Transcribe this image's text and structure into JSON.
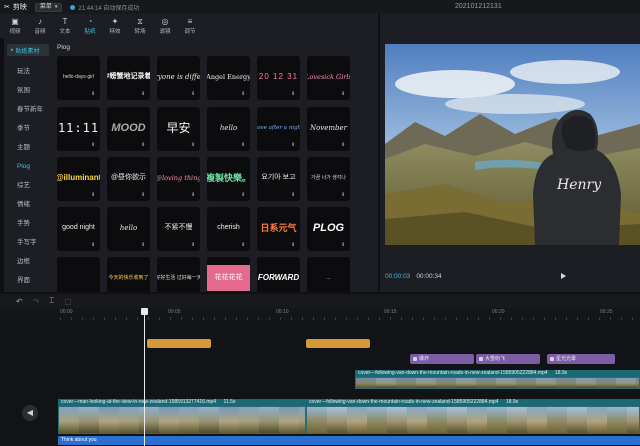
{
  "titlebar": {
    "app_name": "剪映",
    "menu_label": "菜单",
    "save_status": "21:44:14 自动保存成功",
    "project_name": "202101212131"
  },
  "toolbar": {
    "items": [
      {
        "label": "视频",
        "icon": "video-icon",
        "active": false
      },
      {
        "label": "音频",
        "icon": "audio-icon",
        "active": false
      },
      {
        "label": "文本",
        "icon": "text-icon",
        "active": false
      },
      {
        "label": "贴纸",
        "icon": "sticker-icon",
        "active": true
      },
      {
        "label": "特效",
        "icon": "effects-icon",
        "active": false
      },
      {
        "label": "转场",
        "icon": "transition-icon",
        "active": false
      },
      {
        "label": "滤镜",
        "icon": "filter-icon",
        "active": false
      },
      {
        "label": "调节",
        "icon": "adjust-icon",
        "active": false
      }
    ]
  },
  "left_nav": {
    "top_item": "贴纸素材",
    "items": [
      {
        "label": "玩法",
        "active": false
      },
      {
        "label": "氛围",
        "active": false
      },
      {
        "label": "春节新年",
        "active": false
      },
      {
        "label": "季节",
        "active": false
      },
      {
        "label": "主题",
        "active": false
      },
      {
        "label": "Plog",
        "active": true
      },
      {
        "label": "综艺",
        "active": false
      },
      {
        "label": "情绪",
        "active": false
      },
      {
        "label": "手势",
        "active": false
      },
      {
        "label": "手写字",
        "active": false
      },
      {
        "label": "边框",
        "active": false
      },
      {
        "label": "界面",
        "active": false
      }
    ]
  },
  "library": {
    "section_title": "Plog",
    "rows": [
      [
        {
          "text": "hello·days·girl",
          "style": "small"
        },
        {
          "text": "#螃蟹地记录着",
          "style": "bold"
        },
        {
          "text": "Everyone is different",
          "style": "script"
        },
        {
          "text": "Angel Energy",
          "style": "serif"
        },
        {
          "text": "20 12 31",
          "style": "pink"
        },
        {
          "text": "Lovesick Girls",
          "style": "pinkscript"
        }
      ],
      [
        {
          "text": "11:11",
          "style": "digital"
        },
        {
          "text": "MOOD",
          "style": "mood"
        },
        {
          "text": "早安",
          "style": "brush"
        },
        {
          "text": "hello",
          "style": "script"
        },
        {
          "text": "Love after a night",
          "style": "bluescript"
        },
        {
          "text": "November",
          "style": "script"
        }
      ],
      [
        {
          "text": "@illuminant",
          "style": "yellow"
        },
        {
          "text": "@昼你欲示",
          "style": "plain"
        },
        {
          "text": "@loving thing",
          "style": "pinkscript"
        },
        {
          "text": "複製快樂。",
          "style": "green"
        },
        {
          "text": "요기아 보고",
          "style": "plain"
        },
        {
          "text": "가끔 너가 생각나",
          "style": "small"
        }
      ],
      [
        {
          "text": "good night",
          "style": "plain"
        },
        {
          "text": "hello",
          "style": "script"
        },
        {
          "text": "不紧不慢",
          "style": "plain"
        },
        {
          "text": "cherish",
          "style": "plain"
        },
        {
          "text": "日系元气",
          "style": "orange"
        },
        {
          "text": "PLOG",
          "style": "plog"
        }
      ],
      [
        {
          "text": "",
          "style": "blue"
        },
        {
          "text": "今天的快乐收到了",
          "style": "yellowsmall"
        },
        {
          "text": "好好生活 过好每一天",
          "style": "small"
        },
        {
          "text": "花花花花",
          "style": "pinkbox"
        },
        {
          "text": "FORWARD",
          "style": "forward"
        },
        {
          "text": "...",
          "style": "small"
        }
      ]
    ]
  },
  "player": {
    "current_time": "00:00:03",
    "total_time": "00:00:34"
  },
  "timeline": {
    "ruler_ticks": [
      "00:00",
      "00:05",
      "00:10",
      "00:15",
      "00:20",
      "00:25"
    ],
    "effect_clips": [
      {
        "label": "爆炸"
      },
      {
        "label": "大雪纷飞"
      },
      {
        "label": "星光光晕"
      }
    ],
    "video_track_upper": {
      "name": "cover---following-van-down-the-mountain-roads-in-new-zealand-1585905222884.mp4",
      "duration": "18.9s"
    },
    "video_clip_a": {
      "name": "cover---man-looking-at-the-view-in-new-zealand-1585913277416.mp4",
      "duration": "11.5s"
    },
    "video_clip_b": {
      "name": "cover---following-van-down-the-mountain-roads-in-new-zealand-1585905222884.mp4",
      "duration": "18.9s"
    },
    "text_clip": "Think about you"
  },
  "colors": {
    "accent": "#3cc1d6",
    "orange_clip": "#d49a35",
    "purple_clip": "#7b5ea6",
    "video_track": "#1b6a73",
    "text_clip": "#2b6fd0"
  }
}
